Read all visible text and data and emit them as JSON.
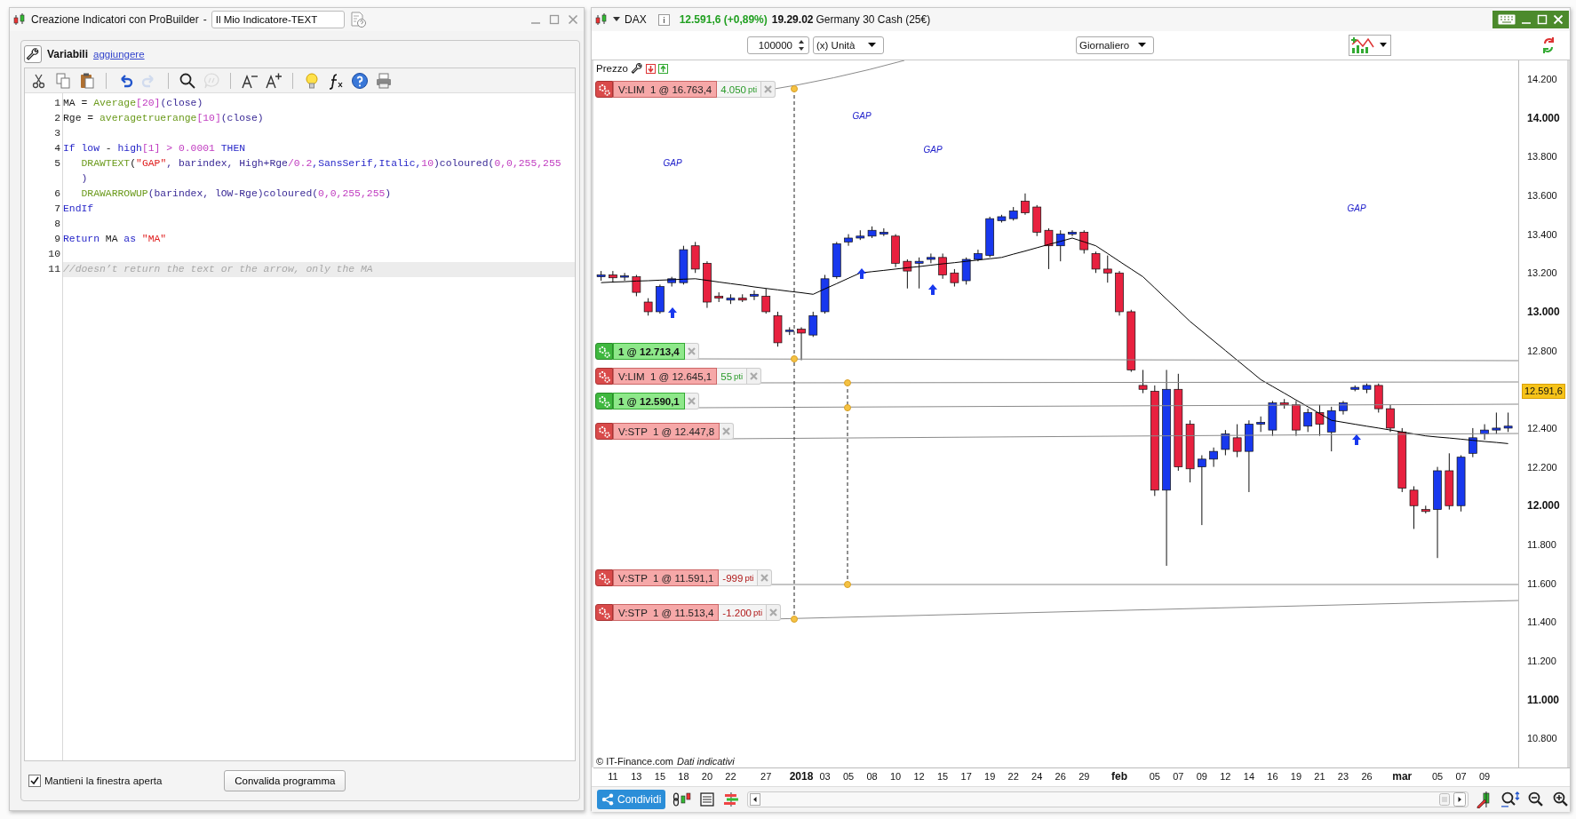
{
  "editor_window": {
    "title": "Creazione Indicatori con ProBuilder",
    "separator": "-",
    "name_value": "Il Mio Indicatore-TEXT",
    "variables_label": "Variabili",
    "add_link": "aggiungere",
    "toolbar": [
      {
        "kind": "cut",
        "disabled": false
      },
      {
        "kind": "copy",
        "disabled": false
      },
      {
        "kind": "paste",
        "disabled": false
      },
      {
        "kind": "undo",
        "disabled": false
      },
      {
        "kind": "redo",
        "disabled": true
      },
      {
        "kind": "search",
        "disabled": false
      },
      {
        "kind": "comment",
        "disabled": true
      },
      {
        "kind": "font-smaller",
        "disabled": false
      },
      {
        "kind": "font-larger",
        "disabled": false
      },
      {
        "kind": "hint",
        "disabled": false
      },
      {
        "kind": "function",
        "disabled": false
      },
      {
        "kind": "help",
        "disabled": false
      },
      {
        "kind": "print",
        "disabled": false
      }
    ],
    "code_lines": [
      {
        "number": "1",
        "highlighted": false,
        "tokens": [
          {
            "kind": "plain",
            "text": "MA = "
          },
          {
            "kind": "function",
            "text": "Average"
          },
          {
            "kind": "number",
            "text": "[20]"
          },
          {
            "kind": "ident",
            "text": "(close)"
          }
        ]
      },
      {
        "number": "2",
        "highlighted": false,
        "tokens": [
          {
            "kind": "plain",
            "text": "Rge = "
          },
          {
            "kind": "function",
            "text": "averagetruerange"
          },
          {
            "kind": "number",
            "text": "[10]"
          },
          {
            "kind": "ident",
            "text": "(close)"
          }
        ]
      },
      {
        "number": "3",
        "highlighted": false
      },
      {
        "number": "4",
        "highlighted": false,
        "tokens": [
          {
            "kind": "keyword",
            "text": "If low"
          },
          {
            "kind": "plain",
            "text": " - "
          },
          {
            "kind": "keyword",
            "text": "high"
          },
          {
            "kind": "number",
            "text": "[1] > 0.0001"
          },
          {
            "kind": "keyword",
            "text": " THEN"
          }
        ]
      },
      {
        "number": "5",
        "highlighted": false,
        "tokens": [
          {
            "kind": "function",
            "text": "   DRAWTEXT"
          },
          {
            "kind": "plain",
            "text": "("
          },
          {
            "kind": "string",
            "text": "\"GAP\""
          },
          {
            "kind": "ident",
            "text": ", barindex, High+Rge"
          },
          {
            "kind": "number",
            "text": "/0.2"
          },
          {
            "kind": "keyword",
            "text": ",SansSerif,Italic,"
          },
          {
            "kind": "number",
            "text": "10"
          },
          {
            "kind": "ident",
            "text": ")coloured("
          },
          {
            "kind": "number",
            "text": "0,0,255,255"
          }
        ],
        "wrap": [
          {
            "kind": "ident",
            "text": "   )"
          }
        ]
      },
      {
        "number": "6",
        "highlighted": false,
        "tokens": [
          {
            "kind": "function",
            "text": "   DRAWARROWUP"
          },
          {
            "kind": "ident",
            "text": "(barindex, lOW-Rge)coloured("
          },
          {
            "kind": "number",
            "text": "0,0,255,255"
          },
          {
            "kind": "ident",
            "text": ")"
          }
        ]
      },
      {
        "number": "7",
        "highlighted": false,
        "tokens": [
          {
            "kind": "keyword",
            "text": "EndIf"
          }
        ]
      },
      {
        "number": "8",
        "highlighted": false
      },
      {
        "number": "9",
        "highlighted": false,
        "tokens": [
          {
            "kind": "keyword",
            "text": "Return"
          },
          {
            "kind": "plain",
            "text": " MA "
          },
          {
            "kind": "keyword",
            "text": "as"
          },
          {
            "kind": "string",
            "text": " \"MA\""
          }
        ]
      },
      {
        "number": "10",
        "highlighted": false
      },
      {
        "number": "11",
        "highlighted": true,
        "tokens": [
          {
            "kind": "comment",
            "text": "//doesn’t return the text or the arrow, only the MA"
          }
        ]
      }
    ],
    "keep_open": {
      "label": "Mantieni la finestra aperta",
      "checked": true
    },
    "validate_button": "Convalida programma"
  },
  "chart_window": {
    "instrument": "DAX",
    "price_change": "12.591,6 (+0,89%)",
    "time": "19.29.02",
    "description": "Germany 30 Cash (25€)",
    "quantity": "100000",
    "unit": "(x) Unità",
    "period": "Giornaliero",
    "panel_label": "Prezzo",
    "orders": [
      {
        "kind": "sell",
        "text": "V:LIM  1 @ 16.763,4",
        "points": {
          "text": "4.050",
          "unit": "pti",
          "color": "#2a9a2a"
        }
      },
      {
        "kind": "buy",
        "text": "1 @ 12.713,4"
      },
      {
        "kind": "sell",
        "text": "V:LIM  1 @ 12.645,1",
        "points": {
          "text": "55",
          "unit": "pti",
          "color": "#2a9a2a"
        }
      },
      {
        "kind": "buy",
        "text": "1 @ 12.590,1"
      },
      {
        "kind": "sell",
        "text": "V:STP  1 @ 12.447,8"
      },
      {
        "kind": "sell",
        "text": "V:STP  1 @ 11.591,1",
        "points": {
          "text": "-999",
          "unit": "pti",
          "color": "#b01818"
        }
      },
      {
        "kind": "sell",
        "text": "V:STP  1 @ 11.513,4",
        "points": {
          "text": "-1.200",
          "unit": "pti",
          "color": "#b01818"
        }
      }
    ],
    "gap_labels": [
      "GAP",
      "GAP",
      "GAP",
      "GAP"
    ],
    "last_price": "12.591,6",
    "copyright": "© IT-Finance.com",
    "data_note": "Dati indicativi",
    "share_button": "Condividi",
    "x_label_major": [
      false,
      false,
      false,
      false,
      false,
      false,
      false,
      true,
      false,
      false,
      false,
      false,
      false,
      false,
      false,
      false,
      false,
      false,
      false,
      false,
      true,
      false,
      false,
      false,
      false,
      false,
      false,
      false,
      false,
      false,
      false,
      true,
      false,
      false,
      false
    ],
    "chart_data": {
      "type": "candlestick",
      "categories": [
        null,
        "11",
        null,
        "13",
        null,
        "15",
        null,
        "18",
        null,
        "20",
        null,
        "22",
        null,
        null,
        "27",
        null,
        null,
        "2018",
        null,
        "03",
        null,
        "05",
        null,
        "08",
        null,
        "10",
        null,
        "12",
        null,
        "15",
        null,
        "17",
        null,
        "19",
        null,
        "22",
        null,
        "24",
        null,
        "26",
        null,
        "29",
        null,
        null,
        "feb",
        null,
        null,
        "05",
        null,
        "07",
        null,
        "09",
        null,
        "12",
        null,
        "14",
        null,
        "16",
        null,
        "19",
        null,
        "21",
        null,
        "23",
        null,
        "26",
        null,
        null,
        "mar",
        null,
        null,
        "05",
        null,
        "07",
        null,
        "09",
        null,
        null
      ],
      "ohlc": [
        [
          13180,
          13210,
          13160,
          13190
        ],
        [
          13190,
          13210,
          13150,
          13175
        ],
        [
          13180,
          13200,
          13160,
          13185
        ],
        [
          13180,
          13190,
          13080,
          13100
        ],
        [
          13050,
          13070,
          12980,
          13000
        ],
        [
          13000,
          13140,
          12990,
          13130
        ],
        [
          13150,
          13180,
          13130,
          13170
        ],
        [
          13150,
          13340,
          13140,
          13320
        ],
        [
          13340,
          13360,
          13200,
          13220
        ],
        [
          13250,
          13260,
          13020,
          13050
        ],
        [
          13080,
          13100,
          13050,
          13070
        ],
        [
          13060,
          13090,
          13040,
          13070
        ],
        [
          13070,
          13090,
          13050,
          13060
        ],
        [
          13080,
          13110,
          13060,
          13090
        ],
        [
          13080,
          13120,
          12990,
          13000
        ],
        [
          12980,
          13000,
          12820,
          12840
        ],
        [
          12900,
          12920,
          12880,
          12905
        ],
        [
          12910,
          12920,
          12750,
          12890
        ],
        [
          12880,
          13000,
          12870,
          12980
        ],
        [
          13000,
          13190,
          12990,
          13170
        ],
        [
          13180,
          13360,
          13170,
          13350
        ],
        [
          13360,
          13400,
          13340,
          13380
        ],
        [
          13380,
          13420,
          13370,
          13390
        ],
        [
          13390,
          13440,
          13380,
          13420
        ],
        [
          13400,
          13430,
          13390,
          13410
        ],
        [
          13390,
          13400,
          13230,
          13250
        ],
        [
          13260,
          13270,
          13120,
          13210
        ],
        [
          13250,
          13280,
          13120,
          13260
        ],
        [
          13270,
          13300,
          13250,
          13280
        ],
        [
          13280,
          13300,
          13170,
          13190
        ],
        [
          13200,
          13220,
          13130,
          13150
        ],
        [
          13160,
          13280,
          13140,
          13270
        ],
        [
          13270,
          13320,
          13260,
          13300
        ],
        [
          13290,
          13490,
          13280,
          13480
        ],
        [
          13470,
          13500,
          13460,
          13490
        ],
        [
          13480,
          13540,
          13470,
          13520
        ],
        [
          13570,
          13610,
          13500,
          13510
        ],
        [
          13540,
          13550,
          13390,
          13410
        ],
        [
          13420,
          13430,
          13220,
          13340
        ],
        [
          13340,
          13420,
          13260,
          13400
        ],
        [
          13400,
          13420,
          13390,
          13410
        ],
        [
          13410,
          13420,
          13300,
          13320
        ],
        [
          13300,
          13310,
          13200,
          13220
        ],
        [
          13220,
          13290,
          13150,
          13200
        ],
        [
          13200,
          13210,
          12980,
          13000
        ],
        [
          13000,
          13010,
          12690,
          12700
        ],
        [
          12620,
          12700,
          12580,
          12600
        ],
        [
          12590,
          12620,
          12050,
          12080
        ],
        [
          12080,
          12700,
          11690,
          12600
        ],
        [
          12600,
          12680,
          12180,
          12200
        ],
        [
          12420,
          12440,
          12120,
          12190
        ],
        [
          12200,
          12260,
          11900,
          12240
        ],
        [
          12240,
          12300,
          12200,
          12280
        ],
        [
          12290,
          12390,
          12260,
          12370
        ],
        [
          12350,
          12420,
          12250,
          12280
        ],
        [
          12280,
          12440,
          12070,
          12420
        ],
        [
          12420,
          12460,
          12380,
          12430
        ],
        [
          12390,
          12540,
          12360,
          12530
        ],
        [
          12530,
          12550,
          12500,
          12520
        ],
        [
          12520,
          12540,
          12360,
          12390
        ],
        [
          12410,
          12500,
          12380,
          12480
        ],
        [
          12480,
          12520,
          12360,
          12420
        ],
        [
          12380,
          12510,
          12280,
          12490
        ],
        [
          12490,
          12540,
          12470,
          12530
        ],
        [
          12600,
          12620,
          12590,
          12610
        ],
        [
          12600,
          12630,
          12580,
          12620
        ],
        [
          12620,
          12630,
          12480,
          12500
        ],
        [
          12500,
          12520,
          12380,
          12400
        ],
        [
          12380,
          12400,
          12070,
          12090
        ],
        [
          12080,
          12100,
          11880,
          12000
        ],
        [
          11980,
          12000,
          11960,
          11970
        ],
        [
          11980,
          12200,
          11730,
          12180
        ],
        [
          12180,
          12270,
          11980,
          12000
        ],
        [
          12000,
          12260,
          11970,
          12250
        ],
        [
          12270,
          12400,
          12250,
          12350
        ],
        [
          12370,
          12420,
          12340,
          12390
        ],
        [
          12390,
          12480,
          12370,
          12400
        ],
        [
          12400,
          12480,
          12380,
          12410
        ]
      ],
      "series": [
        {
          "type": "line",
          "color": "#000000",
          "values": [
            13150,
            13153,
            13155,
            13158,
            13160,
            13163,
            13165,
            13168,
            13170,
            13162,
            13153,
            13145,
            13137,
            13128,
            13120,
            13113,
            13105,
            13098,
            13090,
            13118,
            13145,
            13173,
            13200,
            13207,
            13213,
            13220,
            13227,
            13233,
            13240,
            13247,
            13253,
            13260,
            13267,
            13273,
            13280,
            13297,
            13313,
            13330,
            13347,
            13363,
            13380,
            13360,
            13340,
            13300,
            13260,
            13220,
            13180,
            13123,
            13065,
            13008,
            12950,
            12900,
            12850,
            12800,
            12750,
            12700,
            12650,
            12615,
            12580,
            12545,
            12510,
            12475,
            12440,
            12430,
            12420,
            12410,
            12400,
            12390,
            12380,
            12370,
            12360,
            12354,
            12349,
            12343,
            12337,
            12331,
            12326,
            12320
          ]
        }
      ],
      "ylim": [
        10650,
        14296
      ],
      "yticks": [
        {
          "value": 14200,
          "label": "14.200"
        },
        {
          "value": 14000,
          "label": "14.000"
        },
        {
          "value": 13800,
          "label": "13.800"
        },
        {
          "value": 13600,
          "label": "13.600"
        },
        {
          "value": 13400,
          "label": "13.400"
        },
        {
          "value": 13200,
          "label": "13.200"
        },
        {
          "value": 13000,
          "label": "13.000"
        },
        {
          "value": 12800,
          "label": "12.800"
        },
        {
          "value": 12400,
          "label": "12.400"
        },
        {
          "value": 12200,
          "label": "12.200"
        },
        {
          "value": 12000,
          "label": "12.000"
        },
        {
          "value": 11800,
          "label": "11.800"
        },
        {
          "value": 11600,
          "label": "11.600"
        },
        {
          "value": 11400,
          "label": "11.400"
        },
        {
          "value": 11200,
          "label": "11.200"
        },
        {
          "value": 11000,
          "label": "11.000"
        },
        {
          "value": 10800,
          "label": "10.800"
        }
      ]
    }
  }
}
